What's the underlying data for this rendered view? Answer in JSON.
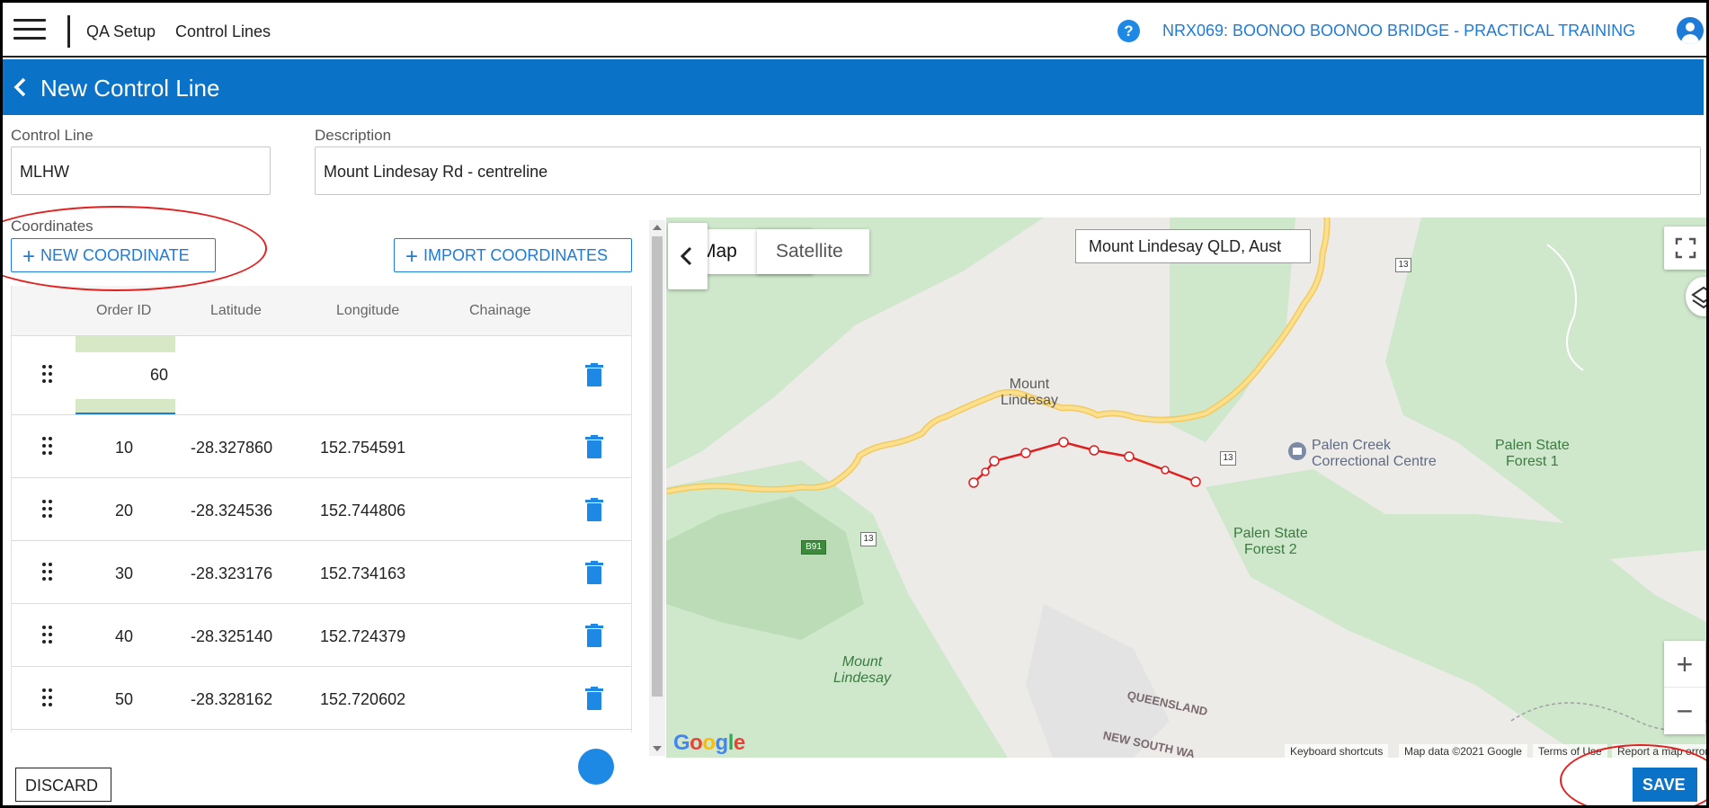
{
  "header": {
    "breadcrumb_1": "QA Setup",
    "breadcrumb_2": "Control Lines",
    "project": "NRX069: BOONOO BOONOO BRIDGE - PRACTICAL TRAINING",
    "help": "?"
  },
  "page": {
    "title": "New Control Line"
  },
  "form": {
    "control_line_label": "Control Line",
    "control_line_value": "MLHW",
    "description_label": "Description",
    "description_value": "Mount Lindesay Rd - centreline"
  },
  "coordinates": {
    "label": "Coordinates",
    "new_button": "NEW COORDINATE",
    "import_button": "IMPORT COORDINATES",
    "columns": [
      "Order ID",
      "Latitude",
      "Longitude",
      "Chainage"
    ],
    "editing_order_id": "60",
    "rows": [
      {
        "order": "10",
        "lat": "-28.327860",
        "lon": "152.754591"
      },
      {
        "order": "20",
        "lat": "-28.324536",
        "lon": "152.744806"
      },
      {
        "order": "30",
        "lat": "-28.323176",
        "lon": "152.734163"
      },
      {
        "order": "40",
        "lat": "-28.325140",
        "lon": "152.724379"
      },
      {
        "order": "50",
        "lat": "-28.328162",
        "lon": "152.720602"
      }
    ]
  },
  "map": {
    "map_button": "Map",
    "satellite_button": "Satellite",
    "search_value": "Mount Lindesay QLD, Aust",
    "labels": {
      "mount_lindesay_1": "Mount\nLindesay",
      "mount_lindesay_2": "Mount\nLindesay",
      "palen_creek": "Palen Creek\nCorrectional Centre",
      "palen_forest_1": "Palen State\nForest 1",
      "palen_forest_2": "Palen State\nForest 2",
      "queensland": "QUEENSLAND",
      "nsw": "NEW SOUTH WA"
    },
    "shields": {
      "r13a": "13",
      "r13b": "13",
      "r13c": "13",
      "b91": "B91"
    },
    "attribution": {
      "shortcuts": "Keyboard shortcuts",
      "data": "Map data ©2021 Google",
      "terms": "Terms of Use",
      "report": "Report a map error"
    },
    "logo": "Google",
    "zoom_in": "+",
    "zoom_out": "−",
    "colors": {
      "line": "#e01e1e",
      "road": "#f9d773",
      "forest": "#cfe8cc"
    }
  },
  "footer": {
    "discard": "DISCARD",
    "save": "SAVE"
  }
}
